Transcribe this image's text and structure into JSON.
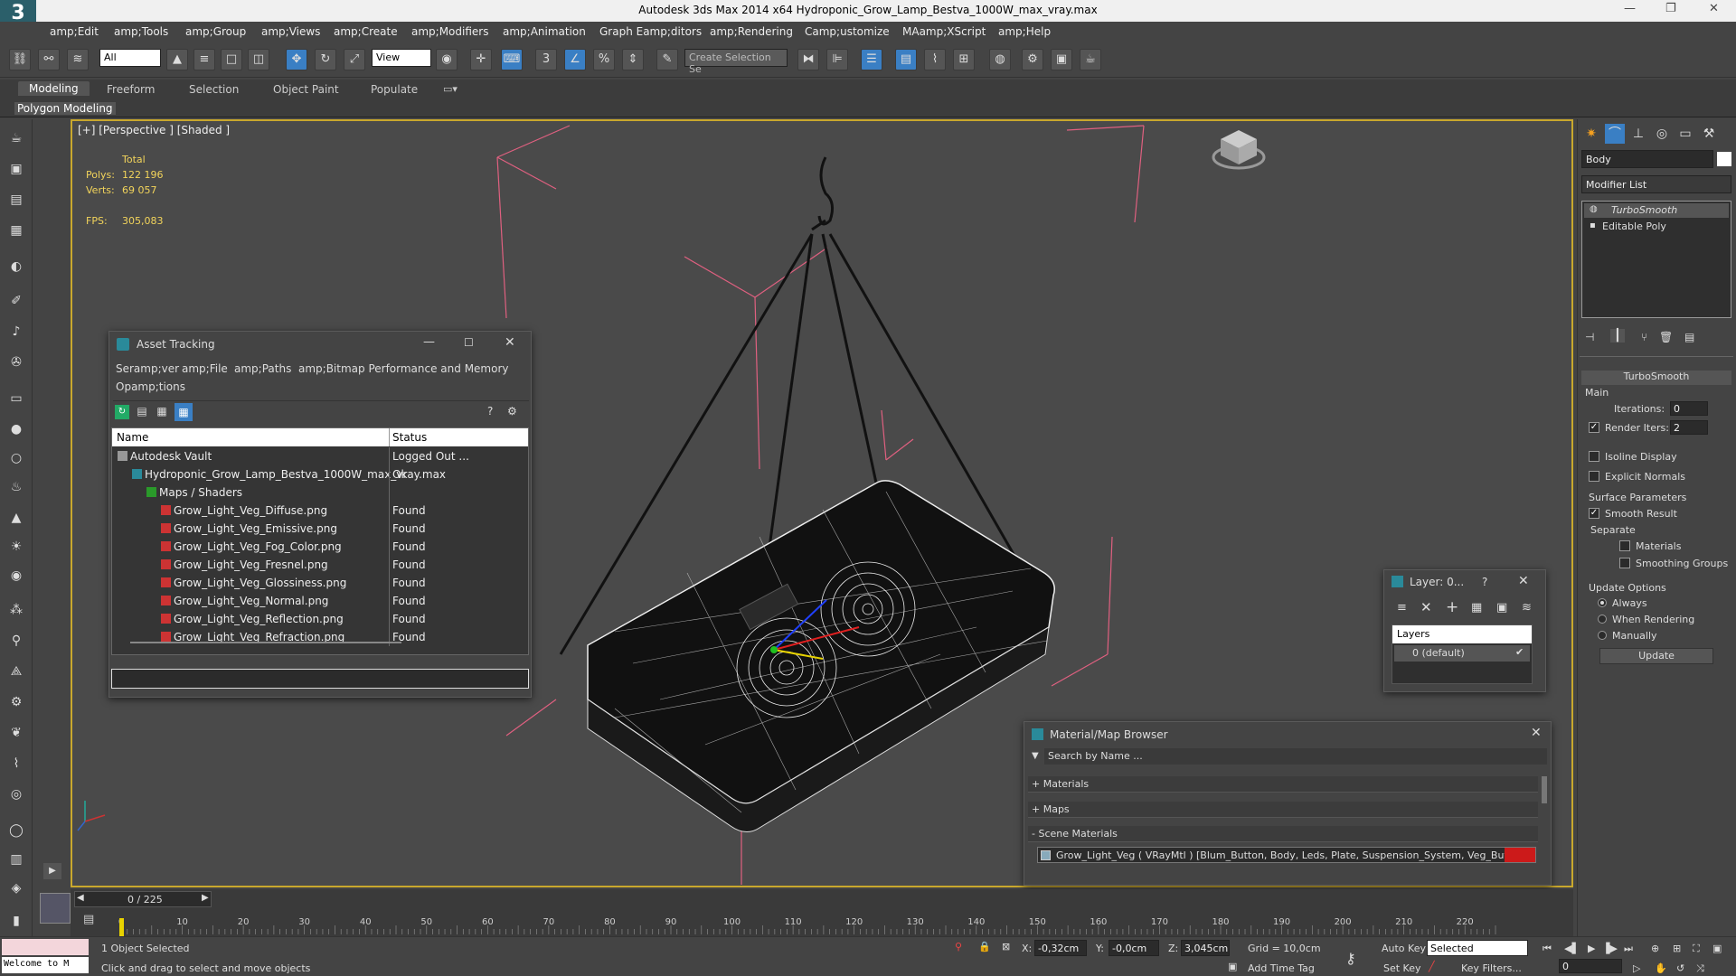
{
  "app": {
    "title": "Autodesk 3ds Max  2014 x64    Hydroponic_Grow_Lamp_Bestva_1000W_max_vray.max",
    "logo": "3"
  },
  "menubar": [
    "amp;Edit",
    "amp;Tools",
    "amp;Group",
    "amp;Views",
    "amp;Create",
    "amp;Modifiers",
    "amp;Animation",
    "Graph Eamp;ditors",
    "amp;Rendering",
    "Camp;ustomize",
    "MAamp;XScript",
    "amp;Help"
  ],
  "toolbar": {
    "selection_filter": "All",
    "ref_coord": "View",
    "named_selection_placeholder": "Create Selection Se"
  },
  "ribbon": {
    "tabs": [
      "Modeling",
      "Freeform",
      "Selection",
      "Object Paint",
      "Populate"
    ],
    "active_tab": "Modeling",
    "sub_label": "Polygon Modeling"
  },
  "viewport": {
    "label": "[+] [Perspective ] [Shaded ]",
    "stats": {
      "total_label": "Total",
      "polys_label": "Polys:",
      "polys": "122 196",
      "verts_label": "Verts:",
      "verts": "69 057",
      "fps_label": "FPS:",
      "fps": "305,083"
    }
  },
  "asset_tracking": {
    "title": "Asset Tracking",
    "menu": [
      "Seramp;ver",
      "amp;File",
      "amp;Paths",
      "amp;Bitmap Performance and Memory",
      "Opamp;tions"
    ],
    "columns": [
      "Name",
      "Status"
    ],
    "rows": [
      {
        "name": "Autodesk Vault",
        "status": "Logged Out ...",
        "indent": 0
      },
      {
        "name": "Hydroponic_Grow_Lamp_Bestva_1000W_max_vray.max",
        "status": "Ok",
        "indent": 1
      },
      {
        "name": "Maps / Shaders",
        "status": "",
        "indent": 2
      },
      {
        "name": "Grow_Light_Veg_Diffuse.png",
        "status": "Found",
        "indent": 3
      },
      {
        "name": "Grow_Light_Veg_Emissive.png",
        "status": "Found",
        "indent": 3
      },
      {
        "name": "Grow_Light_Veg_Fog_Color.png",
        "status": "Found",
        "indent": 3
      },
      {
        "name": "Grow_Light_Veg_Fresnel.png",
        "status": "Found",
        "indent": 3
      },
      {
        "name": "Grow_Light_Veg_Glossiness.png",
        "status": "Found",
        "indent": 3
      },
      {
        "name": "Grow_Light_Veg_Normal.png",
        "status": "Found",
        "indent": 3
      },
      {
        "name": "Grow_Light_Veg_Reflection.png",
        "status": "Found",
        "indent": 3
      },
      {
        "name": "Grow_Light_Veg_Refraction.png",
        "status": "Found",
        "indent": 3
      }
    ]
  },
  "layer_dialog": {
    "title": "Layer: 0...",
    "help": "?",
    "header": "Layers",
    "item": "0 (default)"
  },
  "material_browser": {
    "title": "Material/Map Browser",
    "search_placeholder": "Search by Name ...",
    "sections": [
      "+ Materials",
      "+ Maps",
      "- Scene Materials"
    ],
    "scene_material": "Grow_Light_Veg  ( VRayMtl ) [Blum_Button, Body, Leds, Plate, Suspension_System, Veg_Button]"
  },
  "command_panel": {
    "object_name": "Body",
    "modifier_list": "Modifier List",
    "stack": [
      "TurboSmooth",
      "Editable Poly"
    ],
    "rollout_title": "TurboSmooth",
    "main_label": "Main",
    "iterations_label": "Iterations:",
    "iterations": "0",
    "render_iters_label": "Render Iters:",
    "render_iters": "2",
    "isoline": "Isoline Display",
    "explicit_normals": "Explicit Normals",
    "surface_params": "Surface Parameters",
    "smooth_result": "Smooth Result",
    "separate": "Separate",
    "materials": "Materials",
    "smoothing_groups": "Smoothing Groups",
    "update_options": "Update Options",
    "always": "Always",
    "when_rendering": "When Rendering",
    "manually": "Manually",
    "update_btn": "Update"
  },
  "timeline": {
    "frame": "0 / 225",
    "ticks": [
      "0",
      "10",
      "20",
      "30",
      "40",
      "50",
      "60",
      "70",
      "80",
      "90",
      "100",
      "110",
      "120",
      "130",
      "140",
      "150",
      "160",
      "170",
      "180",
      "190",
      "200",
      "210",
      "220"
    ]
  },
  "status": {
    "script_box": "Welcome to M",
    "selected": "1 Object Selected",
    "prompt": "Click and drag to select and move objects",
    "x_label": "X:",
    "x": "-0,32cm",
    "y_label": "Y:",
    "y": "-0,0cm",
    "z_label": "Z:",
    "z": "3,045cm",
    "grid": "Grid = 10,0cm",
    "add_time_tag": "Add Time Tag",
    "auto_key": "Auto Key",
    "set_key": "Set Key",
    "selected_mode": "Selected",
    "key_filters": "Key Filters...",
    "frame_field": "0"
  },
  "colors": {
    "accent": "#3a7fc4",
    "viewport_border": "#c9a82d",
    "stats_yellow": "#f2d45b",
    "material_swatch": "#cc1a1a"
  }
}
